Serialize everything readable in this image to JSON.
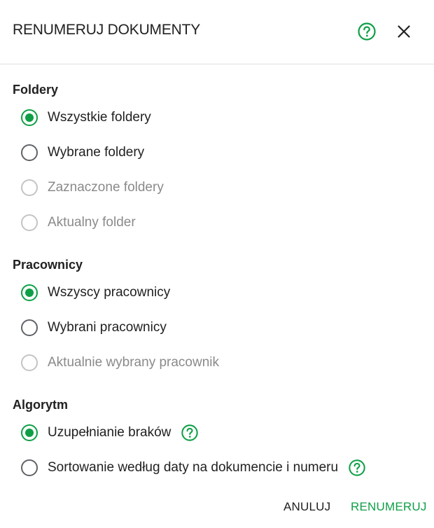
{
  "header": {
    "title": "RENUMERUJ DOKUMENTY",
    "help_icon": "help-circle-icon",
    "close_icon": "close-icon"
  },
  "sections": {
    "foldery": {
      "title": "Foldery",
      "options": [
        {
          "label": "Wszystkie foldery",
          "checked": true,
          "disabled": false
        },
        {
          "label": "Wybrane foldery",
          "checked": false,
          "disabled": false
        },
        {
          "label": "Zaznaczone foldery",
          "checked": false,
          "disabled": true
        },
        {
          "label": "Aktualny folder",
          "checked": false,
          "disabled": true
        }
      ]
    },
    "pracownicy": {
      "title": "Pracownicy",
      "options": [
        {
          "label": "Wszyscy pracownicy",
          "checked": true,
          "disabled": false
        },
        {
          "label": "Wybrani pracownicy",
          "checked": false,
          "disabled": false
        },
        {
          "label": "Aktualnie wybrany pracownik",
          "checked": false,
          "disabled": true
        }
      ]
    },
    "algorytm": {
      "title": "Algorytm",
      "options": [
        {
          "label": "Uzupełnianie braków",
          "checked": true,
          "disabled": false,
          "help_icon": "help-circle-icon"
        },
        {
          "label": "Sortowanie według daty na dokumencie i numeru",
          "checked": false,
          "disabled": false,
          "help_icon": "help-circle-icon"
        }
      ]
    }
  },
  "footer": {
    "cancel_label": "ANULUJ",
    "confirm_label": "RENUMERUJ"
  },
  "colors": {
    "accent": "#0e9f46",
    "text": "#212121",
    "disabled_text": "#8a8a8a"
  }
}
